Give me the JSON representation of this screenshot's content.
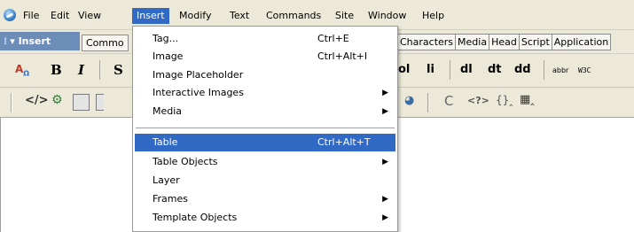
{
  "menubar": {
    "items": [
      "File",
      "Edit",
      "View",
      "Insert",
      "Modify",
      "Text",
      "Commands",
      "Site",
      "Window",
      "Help"
    ],
    "active": "Insert"
  },
  "insert_panel": {
    "title": "Insert",
    "left_tab": "Commo",
    "right_tabs": [
      "Characters",
      "Media",
      "Head",
      "Script",
      "Application"
    ]
  },
  "toolbar_text": {
    "bold": "B",
    "italic": "I",
    "strong": "S",
    "ol": "ol",
    "li": "li",
    "dl": "dl",
    "dt": "dt",
    "dd": "dd",
    "abbr": "abbr",
    "w3c": "W3C"
  },
  "dropdown": {
    "items": [
      {
        "label": "Tag...",
        "shortcut": "Ctrl+E",
        "submenu": false
      },
      {
        "label": "Image",
        "shortcut": "Ctrl+Alt+I",
        "submenu": false
      },
      {
        "label": "Image Placeholder",
        "shortcut": "",
        "submenu": false
      },
      {
        "label": "Interactive Images",
        "shortcut": "",
        "submenu": true
      },
      {
        "label": "Media",
        "shortcut": "",
        "submenu": true
      },
      {
        "label": "Table",
        "shortcut": "Ctrl+Alt+T",
        "submenu": false,
        "highlighted": true
      },
      {
        "label": "Table Objects",
        "shortcut": "",
        "submenu": true
      },
      {
        "label": "Layer",
        "shortcut": "",
        "submenu": false
      },
      {
        "label": "Frames",
        "shortcut": "",
        "submenu": true
      },
      {
        "label": "Template Objects",
        "shortcut": "",
        "submenu": true
      }
    ]
  },
  "colors": {
    "highlight": "#316ac5",
    "chrome": "#ece9d8",
    "panel_title": "#6b8db8"
  }
}
